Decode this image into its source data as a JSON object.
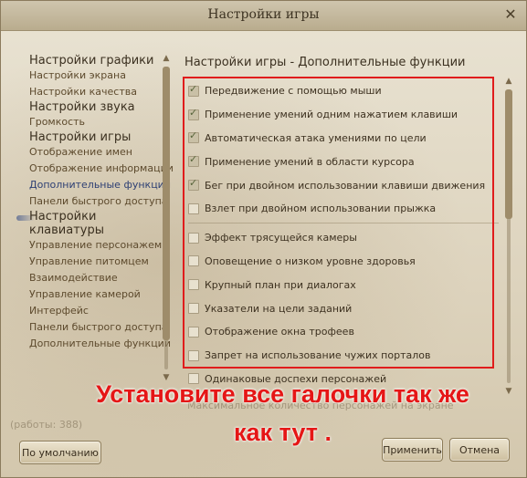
{
  "window": {
    "title": "Настройки игры",
    "close_glyph": "✕"
  },
  "nav": {
    "groups": [
      {
        "label": "Настройки графики",
        "items": [
          "Настройки экрана",
          "Настройки качества"
        ]
      },
      {
        "label": "Настройки звука",
        "items": [
          "Громкость"
        ]
      },
      {
        "label": "Настройки игры",
        "items": [
          "Отображение имен",
          "Отображение информации",
          "Дополнительные функции",
          "Панели быстрого доступа"
        ],
        "active_index": 2
      },
      {
        "label": "Настройки клавиатуры",
        "items": [
          "Управление персонажем",
          "Управление питомцем",
          "Взаимодействие",
          "Управление камерой",
          "Интерфейс",
          "Панели быстрого доступа",
          "Дополнительные функции"
        ]
      }
    ]
  },
  "section_title": "Настройки игры - Дополнительные функции",
  "options_a": [
    {
      "label": "Передвижение с помощью мыши",
      "checked": true
    },
    {
      "label": "Применение умений одним нажатием клавиши",
      "checked": true
    },
    {
      "label": "Автоматическая атака умениями по цели",
      "checked": true
    },
    {
      "label": "Применение умений в области курсора",
      "checked": true
    },
    {
      "label": "Бег при двойном использовании клавиши движения",
      "checked": true
    },
    {
      "label": "Взлет при двойном использовании прыжка",
      "checked": false
    }
  ],
  "options_b": [
    {
      "label": "Эффект трясущейся камеры",
      "checked": false
    },
    {
      "label": "Оповещение о низком уровне здоровья",
      "checked": false
    },
    {
      "label": "Крупный план при диалогах",
      "checked": false
    },
    {
      "label": "Указатели на цели заданий",
      "checked": false
    },
    {
      "label": "Отображение окна трофеев",
      "checked": false
    },
    {
      "label": "Запрет на использование чужих порталов",
      "checked": false
    },
    {
      "label": "Одинаковые доспехи персонажей",
      "checked": false
    }
  ],
  "partial_option": "Максимальное количество персонажей на экране",
  "ghost_text": "(работы: 388)",
  "annotation": {
    "line1": "Установите все галочки так же",
    "line2": "как тут .",
    "color": "#e51616"
  },
  "buttons": {
    "default": "По умолчанию",
    "apply": "Применить",
    "cancel": "Отмена"
  },
  "icons": {
    "close": "close-icon",
    "scroll_up": "▲",
    "scroll_down": "▼"
  }
}
